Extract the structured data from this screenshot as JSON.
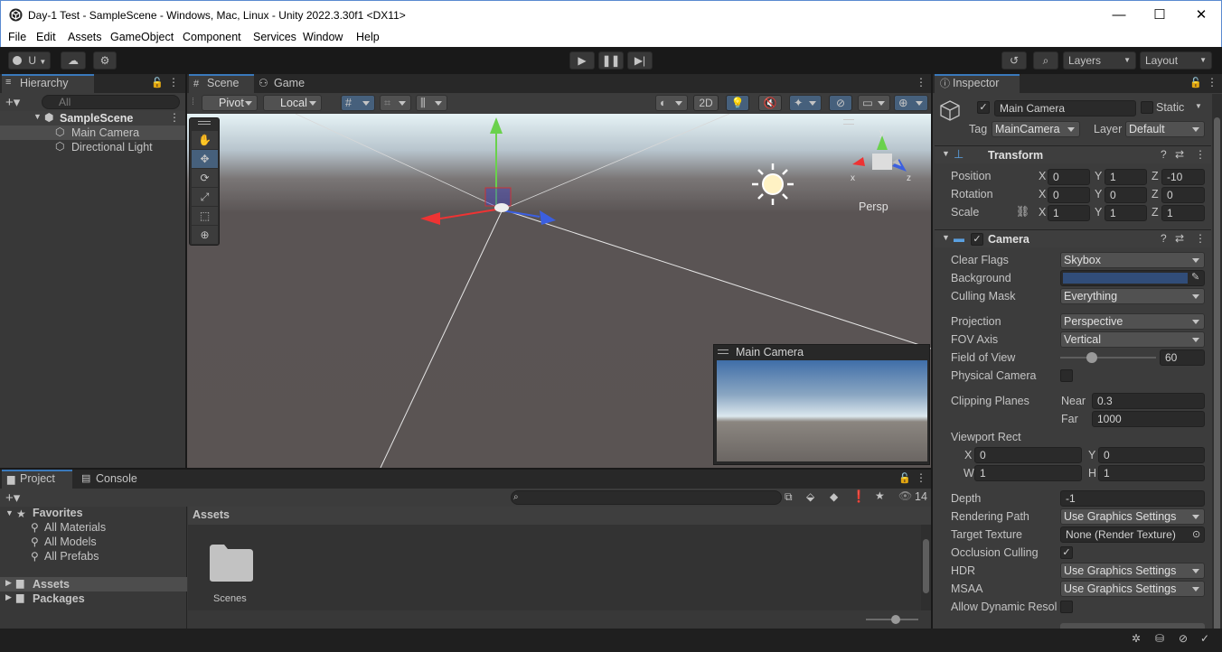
{
  "window": {
    "title": "Day-1 Test - SampleScene - Windows, Mac, Linux - Unity 2022.3.30f1 <DX11>",
    "minimize": "—",
    "maximize": "☐",
    "close": "✕"
  },
  "menu": [
    "File",
    "Edit",
    "Assets",
    "GameObject",
    "Component",
    "Services",
    "Window",
    "Help"
  ],
  "toolbar": {
    "account": "U",
    "layers": "Layers",
    "layout": "Layout"
  },
  "hierarchy": {
    "tab": "Hierarchy",
    "search_placeholder": "All",
    "scene": "SampleScene",
    "items": [
      "Main Camera",
      "Directional Light"
    ]
  },
  "scene_view": {
    "tabs": [
      "Scene",
      "Game"
    ],
    "pivot": "Pivot",
    "local": "Local",
    "mode_2d": "2D",
    "persp": "Persp",
    "preview_title": "Main Camera"
  },
  "inspector": {
    "tab": "Inspector",
    "object_name": "Main Camera",
    "static_label": "Static",
    "tag_label": "Tag",
    "tag": "MainCamera",
    "layer_label": "Layer",
    "layer": "Default",
    "transform": {
      "title": "Transform",
      "position_label": "Position",
      "rotation_label": "Rotation",
      "scale_label": "Scale",
      "position": [
        "0",
        "1",
        "-10"
      ],
      "rotation": [
        "0",
        "0",
        "0"
      ],
      "scale": [
        "1",
        "1",
        "1"
      ],
      "axis": [
        "X",
        "Y",
        "Z"
      ]
    },
    "camera": {
      "title": "Camera",
      "clear_flags_label": "Clear Flags",
      "clear_flags": "Skybox",
      "background_label": "Background",
      "background_color": "#314d79",
      "culling_mask_label": "Culling Mask",
      "culling_mask": "Everything",
      "projection_label": "Projection",
      "projection": "Perspective",
      "fov_axis_label": "FOV Axis",
      "fov_axis": "Vertical",
      "fov_label": "Field of View",
      "fov": "60",
      "fov_fraction": 0.33,
      "physical_label": "Physical Camera",
      "clipping_label": "Clipping Planes",
      "near_label": "Near",
      "near": "0.3",
      "far_label": "Far",
      "far": "1000",
      "viewport_label": "Viewport Rect",
      "vp_x_label": "X",
      "vp_x": "0",
      "vp_y_label": "Y",
      "vp_y": "0",
      "vp_w_label": "W",
      "vp_w": "1",
      "vp_h_label": "H",
      "vp_h": "1",
      "depth_label": "Depth",
      "depth": "-1",
      "rendering_path_label": "Rendering Path",
      "rendering_path": "Use Graphics Settings",
      "target_texture_label": "Target Texture",
      "target_texture": "None (Render Texture)",
      "occlusion_label": "Occlusion Culling",
      "hdr_label": "HDR",
      "hdr": "Use Graphics Settings",
      "msaa_label": "MSAA",
      "msaa": "Use Graphics Settings",
      "dynamic_res_label": "Allow Dynamic Resol"
    }
  },
  "project": {
    "tabs": [
      "Project",
      "Console"
    ],
    "favorites": "Favorites",
    "favorite_items": [
      "All Materials",
      "All Models",
      "All Prefabs"
    ],
    "roots": [
      "Assets",
      "Packages"
    ],
    "breadcrumb": "Assets",
    "folders": [
      "Scenes"
    ],
    "count": "14"
  },
  "colors": {
    "accent": "#3a79bb",
    "selection": "#2c5d87"
  }
}
